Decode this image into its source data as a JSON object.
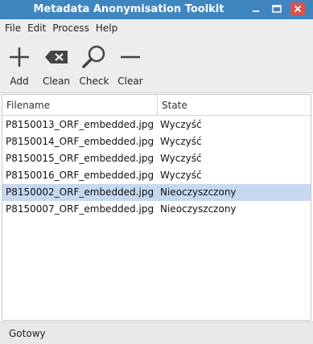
{
  "window": {
    "title": "Metadata Anonymisation Toolkit"
  },
  "menu": [
    "File",
    "Edit",
    "Process",
    "Help"
  ],
  "toolbar": {
    "add": "Add",
    "clean": "Clean",
    "check": "Check",
    "clear": "Clear"
  },
  "table": {
    "headers": {
      "filename": "Filename",
      "state": "State"
    },
    "rows": [
      {
        "filename": "P8150013_ORF_embedded.jpg",
        "state": "Wyczyść"
      },
      {
        "filename": "P8150014_ORF_embedded.jpg",
        "state": "Wyczyść"
      },
      {
        "filename": "P8150015_ORF_embedded.jpg",
        "state": "Wyczyść"
      },
      {
        "filename": "P8150016_ORF_embedded.jpg",
        "state": "Wyczyść"
      },
      {
        "filename": "P8150002_ORF_embedded.jpg",
        "state": "Nieoczyszczony"
      },
      {
        "filename": "P8150007_ORF_embedded.jpg",
        "state": "Nieoczyszczony"
      }
    ],
    "selected_row": 4
  },
  "status": {
    "text": "Gotowy"
  },
  "colors": {
    "titlebar": "#3f86c1",
    "selection": "#c6d8ef",
    "close": "#d9534f"
  }
}
